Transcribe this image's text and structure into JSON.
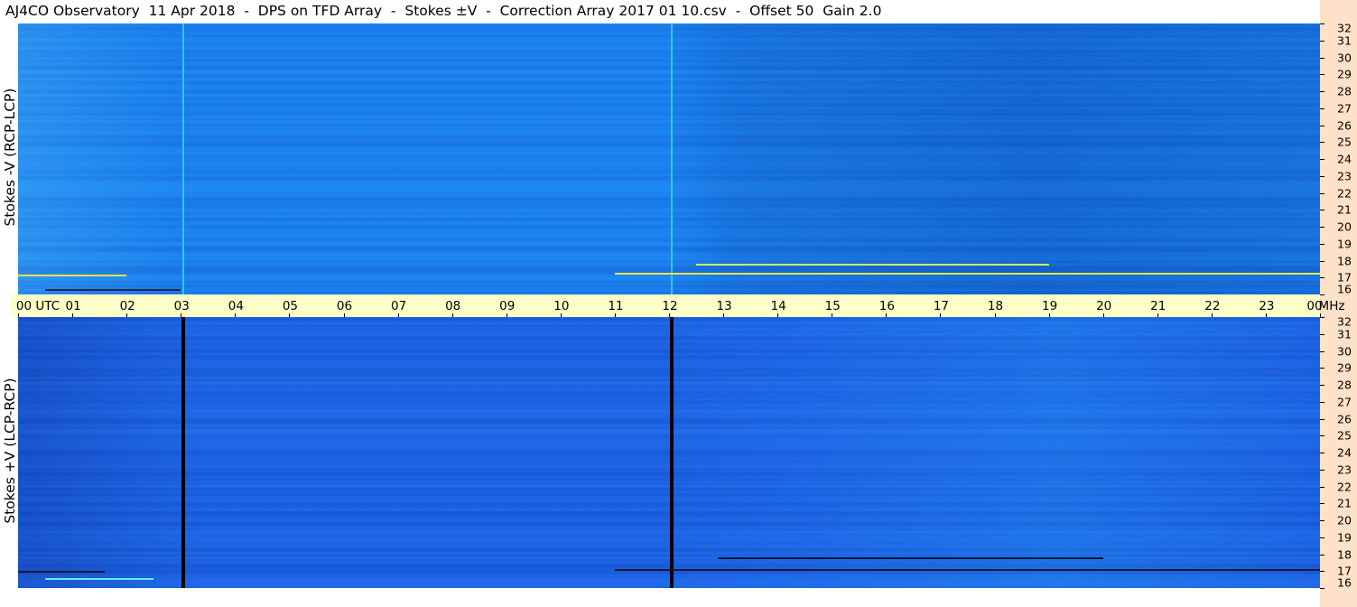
{
  "title": "AJ4CO Observatory  11 Apr 2018  -  DPS on TFD Array  -  Stokes ±V  -  Correction Array 2017 01 10.csv  -  Offset 50  Gain 2.0",
  "chart_data": {
    "type": "heatmap",
    "x_axis": {
      "labels": [
        "00 UTC",
        "01",
        "02",
        "03",
        "04",
        "05",
        "06",
        "07",
        "08",
        "09",
        "10",
        "11",
        "12",
        "13",
        "14",
        "15",
        "16",
        "17",
        "18",
        "19",
        "20",
        "21",
        "22",
        "23",
        "00"
      ],
      "range": [
        0,
        24
      ]
    },
    "y_axis": {
      "unit": "MHz",
      "ticks": [
        "32",
        "31",
        "30",
        "29",
        "28",
        "27",
        "26",
        "25",
        "24",
        "23",
        "22",
        "21",
        "20",
        "19",
        "18",
        "17",
        "16"
      ],
      "range": [
        16,
        32
      ]
    },
    "panels": [
      {
        "name": "Stokes -V (RCP-LCP)",
        "base_color": "#1a82f0",
        "marker_lines": [
          {
            "utc": 3.05,
            "color": "#30c8e8"
          },
          {
            "utc": 12.05,
            "color": "#30c8e8"
          }
        ],
        "features": [
          {
            "utc_start": 0.0,
            "utc_end": 2.0,
            "mhz": 17.2,
            "color": "#f0e040"
          },
          {
            "utc_start": 11.0,
            "utc_end": 24.0,
            "mhz": 17.3,
            "color": "#e8e840"
          },
          {
            "utc_start": 12.5,
            "utc_end": 19.0,
            "mhz": 17.8,
            "color": "#d0f060"
          },
          {
            "utc_start": 0.5,
            "utc_end": 3.0,
            "mhz": 16.3,
            "color": "#20204a"
          }
        ]
      },
      {
        "name": "Stokes +V (LCP-RCP)",
        "base_color": "#1d62e4",
        "marker_lines": [
          {
            "utc": 3.05,
            "color": "#000000"
          },
          {
            "utc": 12.05,
            "color": "#000000"
          }
        ],
        "features": [
          {
            "utc_start": 0.0,
            "utc_end": 1.6,
            "mhz": 17.0,
            "color": "#101830"
          },
          {
            "utc_start": 11.0,
            "utc_end": 24.0,
            "mhz": 17.1,
            "color": "#101830"
          },
          {
            "utc_start": 12.9,
            "utc_end": 20.0,
            "mhz": 17.8,
            "color": "#0a1640"
          },
          {
            "utc_start": 0.5,
            "utc_end": 2.5,
            "mhz": 16.6,
            "color": "#60f0f0"
          }
        ]
      }
    ]
  },
  "colors": {
    "axis_band": "#ffffc8",
    "right_strip": "#fde1c9"
  }
}
